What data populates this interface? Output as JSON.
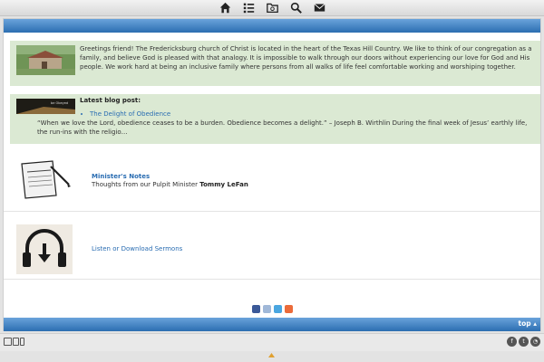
{
  "toolbar": {
    "icons": [
      "home-icon",
      "list-icon",
      "folder-icon",
      "search-icon",
      "mail-icon"
    ]
  },
  "intro": {
    "text": "Greetings friend! The Fredericksburg church of Christ is located in the heart of the Texas Hill Country. We like to think of our congregation as a family, and believe God is pleased with that analogy. It is impossible to walk through our doors without experiencing our love for God and His people. We work hard at being an inclusive family where persons from all walks of life feel comfortable working and worshiping together."
  },
  "blog": {
    "heading": "Latest blog post:",
    "post_title": "The Delight of Obedience",
    "excerpt": "“When we love the Lord, obedience ceases to be a burden. Obedience becomes a delight.” – Joseph B. Wirthlin During the final week of Jesus’ earthly life, the run-ins with the religio…",
    "thumb_caption": "be Obeyed"
  },
  "notes": {
    "title": "Minister's Notes",
    "subtitle": "Thoughts from our Pulpit Minister",
    "minister": "Tommy LeFan"
  },
  "sermons": {
    "link": "Listen or Download Sermons"
  },
  "footer": {
    "top_label": "top"
  },
  "colors": {
    "accent_blue": "#2c6eb1",
    "link_blue": "#2a6db2",
    "green_panel": "#dbe9d3"
  }
}
